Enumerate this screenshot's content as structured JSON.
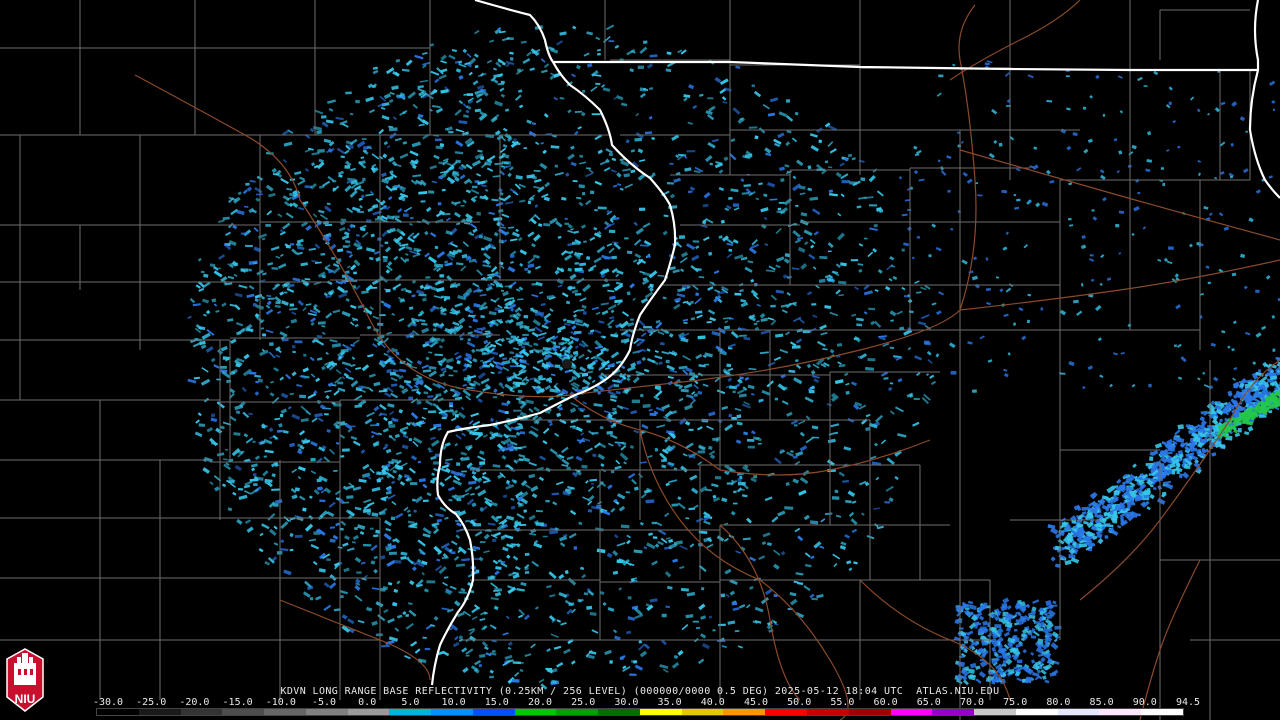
{
  "product": {
    "caption": "KDVN LONG RANGE BASE REFLECTIVITY (0.25KM / 256 LEVEL) (000000/0000 0.5 DEG) 2025-05-12 18:04 UTC  ATLAS.NIU.EDU",
    "station": "KDVN",
    "timestamp": "2025-05-12 18:04 UTC",
    "elevation": "0.5 DEG",
    "source": "ATLAS.NIU.EDU"
  },
  "legend": {
    "tick_labels": [
      "-30.0",
      "-25.0",
      "-20.0",
      "-15.0",
      "-10.0",
      "-5.0",
      "0.0",
      "5.0",
      "10.0",
      "15.0",
      "20.0",
      "25.0",
      "30.0",
      "35.0",
      "40.0",
      "45.0",
      "50.0",
      "55.0",
      "60.0",
      "65.0",
      "70.0",
      "75.0",
      "80.0",
      "85.0",
      "90.0",
      "94.5"
    ],
    "colors": [
      "#000000",
      "#1a1a1a",
      "#333333",
      "#4d4d4d",
      "#666666",
      "#808080",
      "#9a9a9a",
      "#00b4d8",
      "#0090ff",
      "#0050ff",
      "#00c800",
      "#00a000",
      "#007000",
      "#ffff00",
      "#e6c800",
      "#ff9600",
      "#ff0000",
      "#c80000",
      "#a00000",
      "#ff00ff",
      "#9600c8",
      "#c8c8c8",
      "#ffffff",
      "#e6e6ff",
      "#ffe6ff",
      "#ffffff"
    ]
  },
  "logo": {
    "text": "NIU",
    "color": "#c8102e"
  },
  "map_colors": {
    "background": "#000000",
    "county_lines": "#6e6e6e",
    "state_lines": "#ffffff",
    "highways": "#8b4a2b",
    "echo_light": "#36c6ea",
    "echo_blue": "#2a78e8",
    "echo_green": "#22c84a"
  }
}
